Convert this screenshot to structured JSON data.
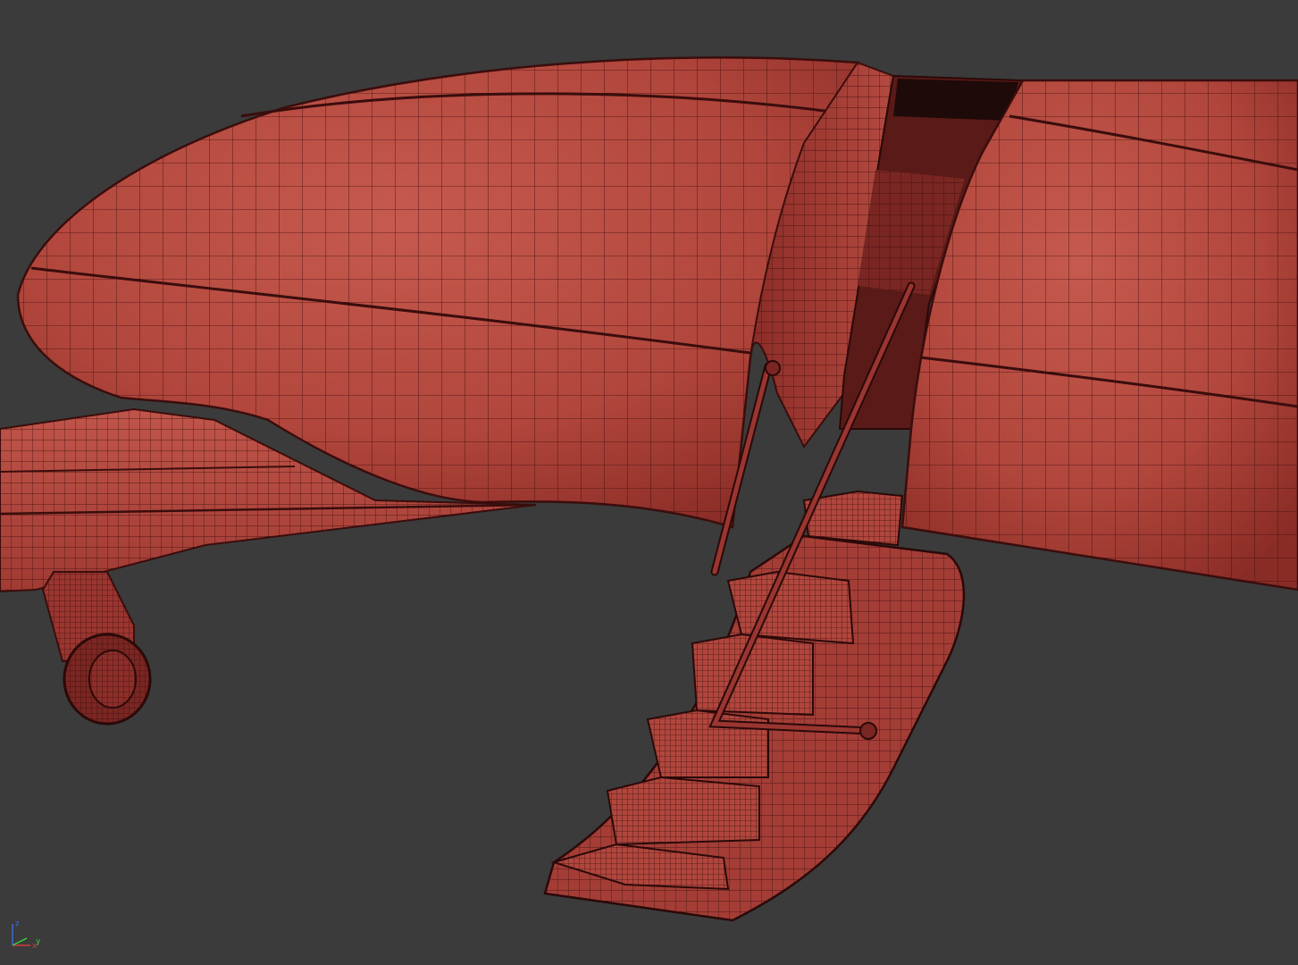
{
  "viewport": {
    "background": "#3b3b3b",
    "mesh_fill": "#b4483e",
    "mesh_shadow": "#7a2420",
    "mesh_highlight": "#cd6a5d",
    "wire_color": "#3a0d0c",
    "interior_dark": "#1e0a08"
  },
  "axis_gizmo": {
    "x_label": "x",
    "y_label": "y",
    "z_label": "z",
    "x_color": "#d23a3a",
    "y_color": "#3ad23a",
    "z_color": "#3a6ad2"
  }
}
